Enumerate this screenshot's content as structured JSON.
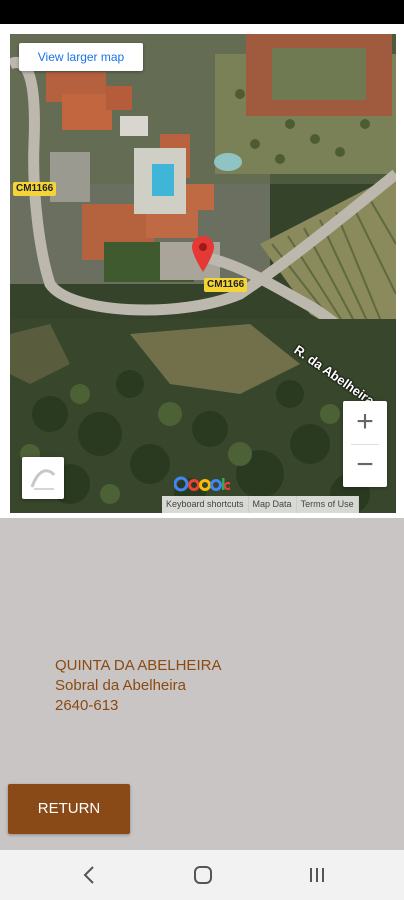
{
  "map": {
    "larger_map_link": "View larger map",
    "road_label_1": "CM1166",
    "road_label_2": "CM1166",
    "street_label": "R. da Abelheira",
    "zoom_in": "+",
    "zoom_out": "−",
    "attribution": {
      "shortcuts": "Keyboard shortcuts",
      "data": "Map Data",
      "terms": "Terms of Use"
    },
    "pin_color": "#e53935"
  },
  "location": {
    "name": "QUINTA DA ABELHEIRA",
    "place": "Sobral da Abelheira",
    "postal": "2640-613"
  },
  "actions": {
    "return_label": "RETURN"
  },
  "colors": {
    "accent": "#8a4a18",
    "panel": "#c9c5c4",
    "text": "#8a4a12"
  }
}
